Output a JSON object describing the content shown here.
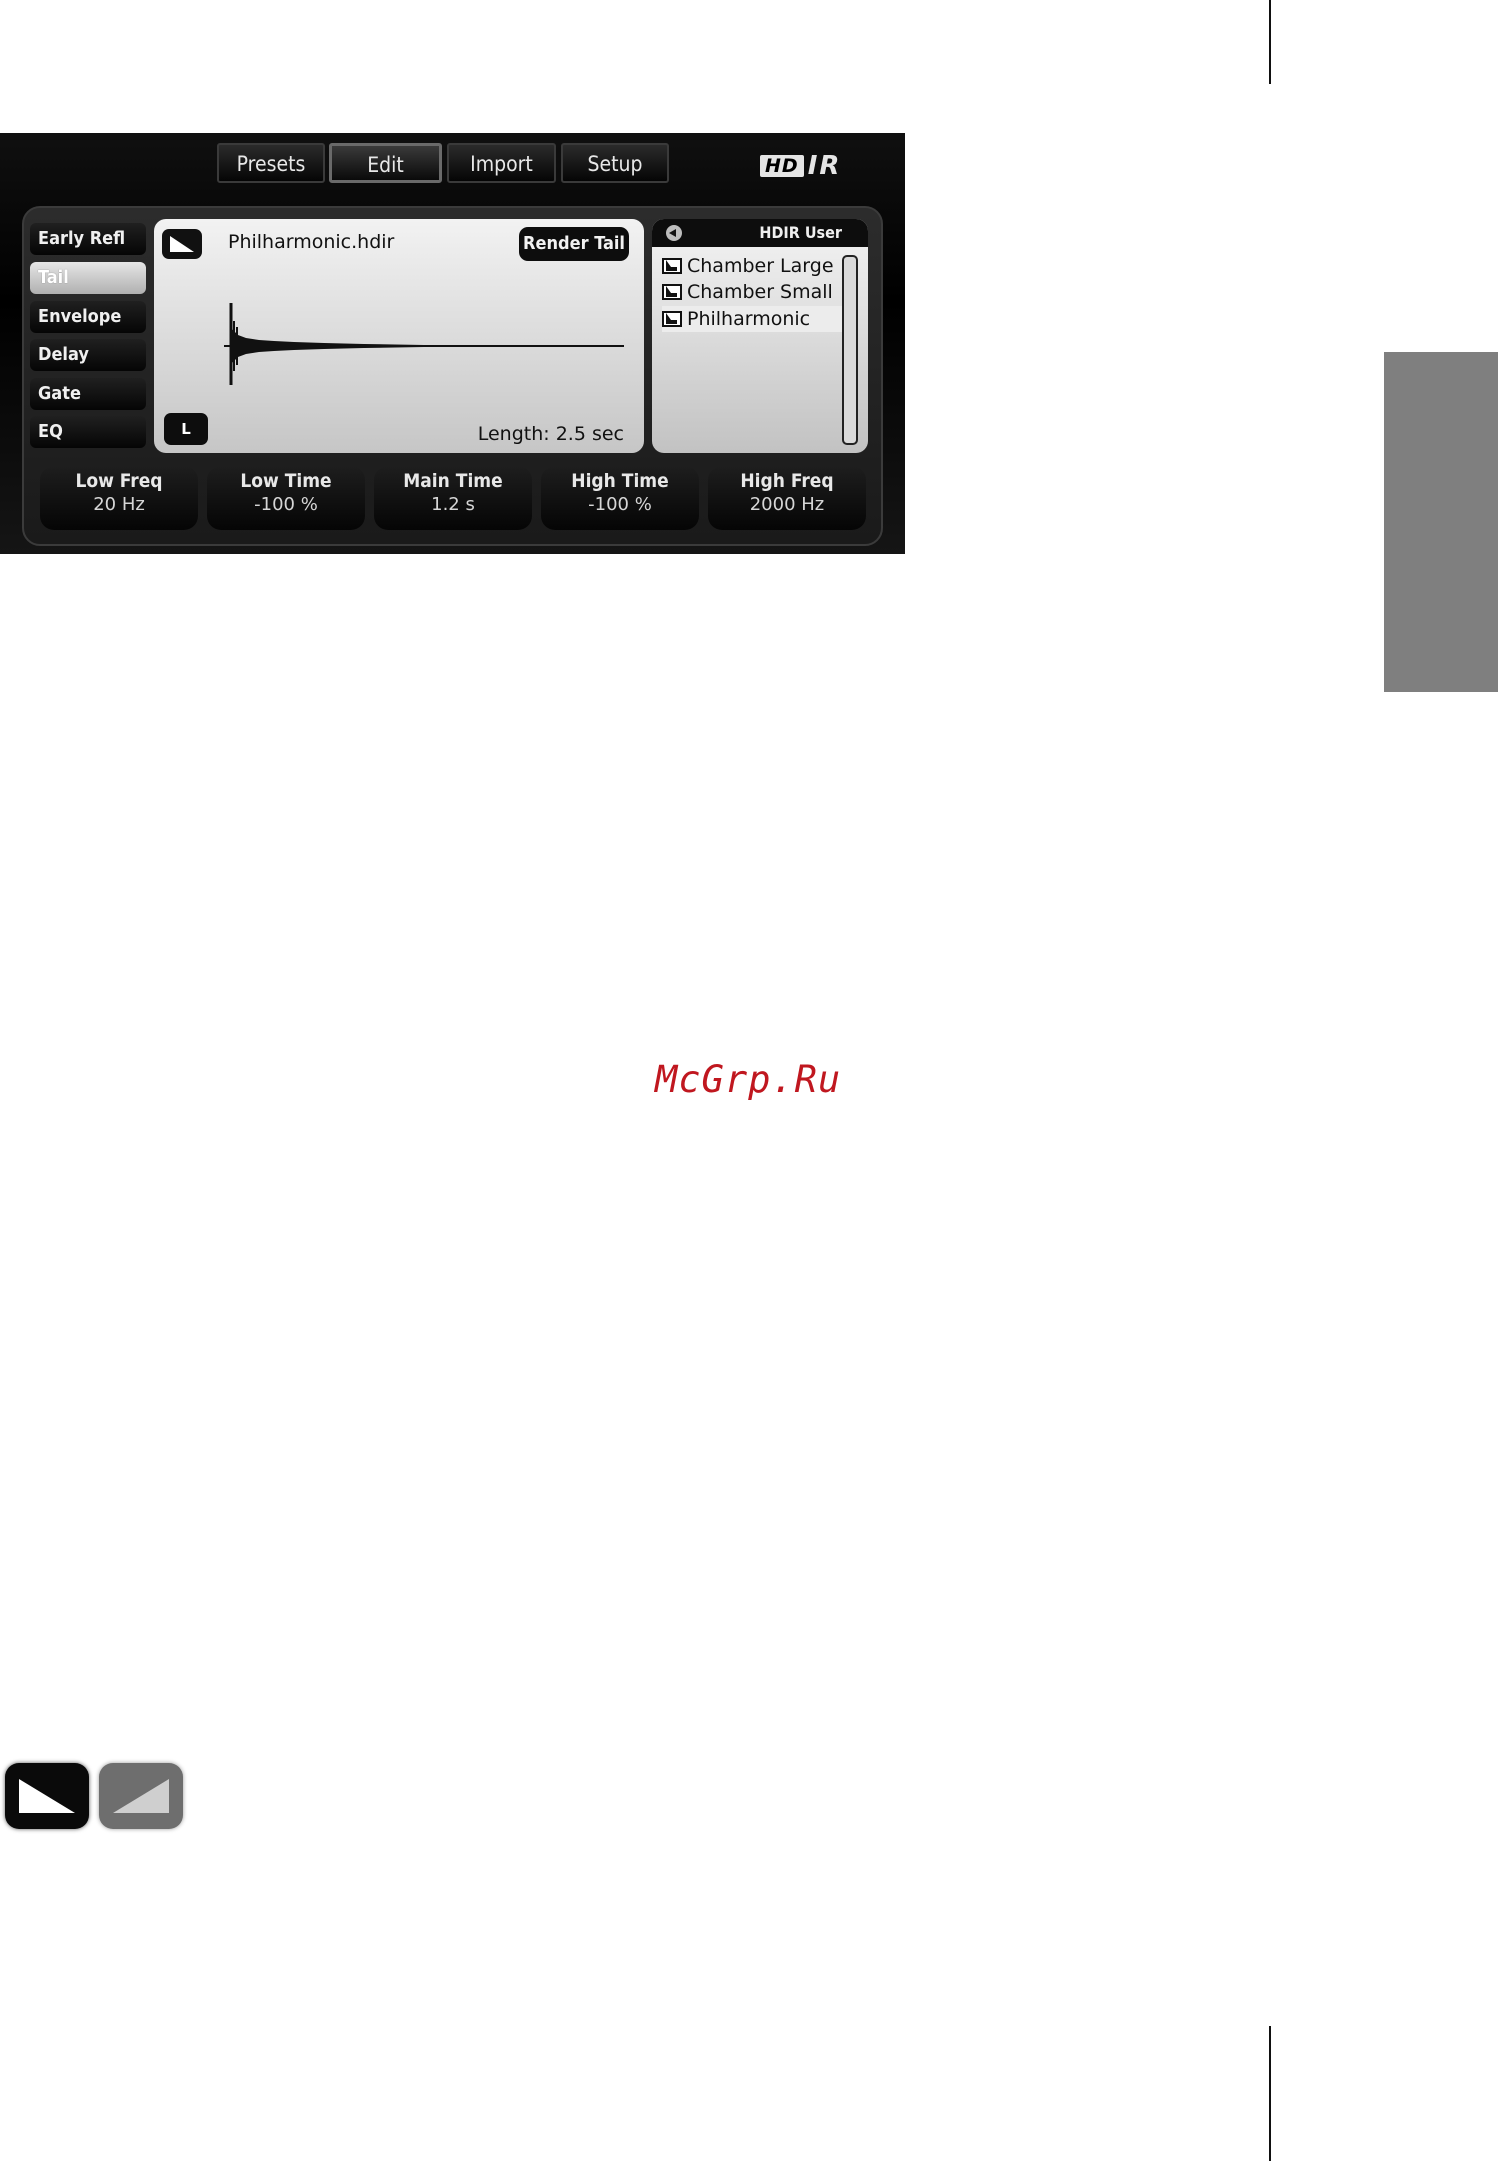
{
  "header": {
    "tabs": [
      {
        "label": "Presets"
      },
      {
        "label": "Edit"
      },
      {
        "label": "Import"
      },
      {
        "label": "Setup"
      }
    ],
    "logo": {
      "hd": "HD",
      "ir": "IR"
    }
  },
  "sidebar": {
    "items": [
      {
        "label": "Early Refl"
      },
      {
        "label": "Tail"
      },
      {
        "label": "Envelope"
      },
      {
        "label": "Delay"
      },
      {
        "label": "Gate"
      },
      {
        "label": "EQ"
      }
    ],
    "active": "Tail"
  },
  "waveform": {
    "filename": "Philharmonic.hdir",
    "render_label": "Render Tail",
    "length": "Length: 2.5 sec",
    "channel": "L"
  },
  "library": {
    "title": "HDIR User",
    "items": [
      {
        "label": "Chamber Large"
      },
      {
        "label": "Chamber Small"
      },
      {
        "label": "Philharmonic"
      }
    ],
    "selected": "Philharmonic"
  },
  "knobs": [
    {
      "label": "Low Freq",
      "value": "20 Hz"
    },
    {
      "label": "Low Time",
      "value": "-100 %"
    },
    {
      "label": "Main Time",
      "value": "1.2 s"
    },
    {
      "label": "High Time",
      "value": "-100 %"
    },
    {
      "label": "High Freq",
      "value": "2000 Hz"
    }
  ],
  "watermark": "McGrp.Ru",
  "icons": {
    "fade_out": "fade-out-icon",
    "fade_in": "fade-in-icon"
  }
}
